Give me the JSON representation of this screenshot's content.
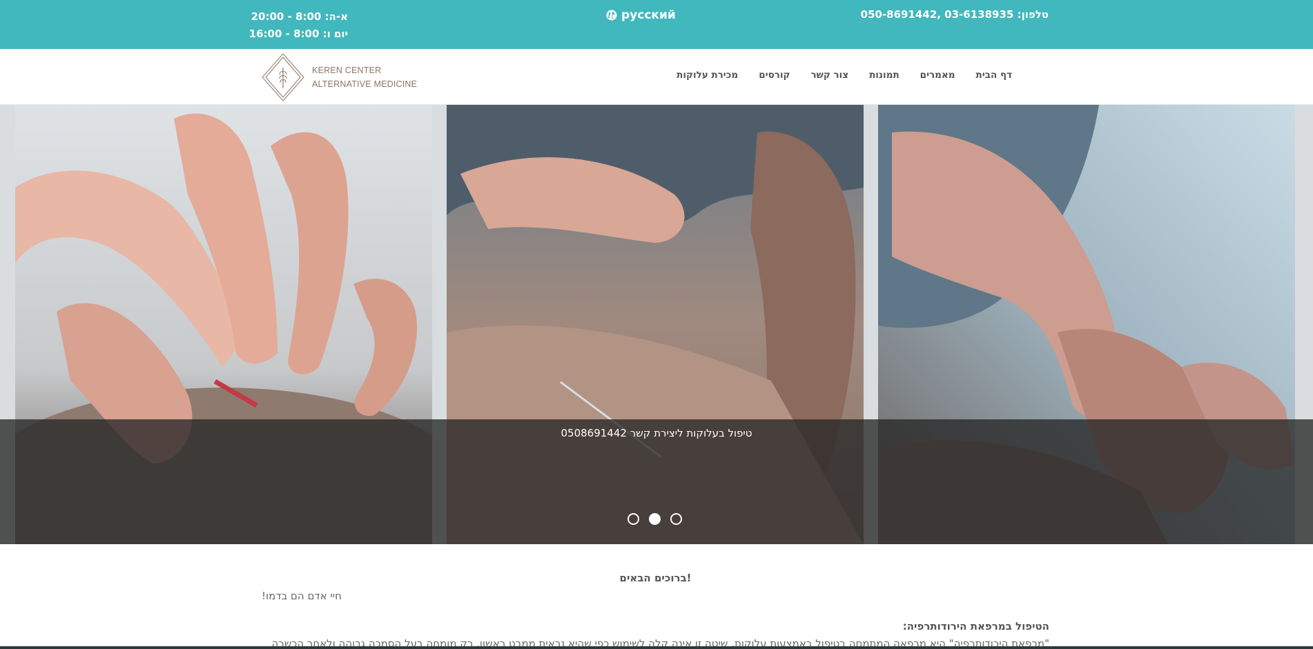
{
  "topbar": {
    "hours_weekdays": "א-ה: 8:00 - 20:00",
    "hours_friday": "יום ו: 8:00 - 16:00",
    "language_label": "русский",
    "language_icon": "globe-icon",
    "phone": "טלפון: 03-6138935 ,050-8691442"
  },
  "logo": {
    "line1": "KEREN CENTER",
    "line2": "ALTERNATIVE MEDICINE"
  },
  "nav": {
    "items": [
      {
        "label": "דף הבית"
      },
      {
        "label": "מאמרים"
      },
      {
        "label": "תמונות"
      },
      {
        "label": "צור קשר"
      },
      {
        "label": "קורסים"
      },
      {
        "label": "מכירת עלוקות"
      }
    ]
  },
  "slider": {
    "caption": "טיפול בעלוקות ליצירת קשר 0508691442",
    "total_slides": 3,
    "active_slide": 2
  },
  "content": {
    "welcome": "ברוכים הבאים!",
    "tagline": "חיי אדם הם בדמו!",
    "section_title": "הטיפול במרפאת הירודותרפיה:",
    "paragraph": "\"מרפאת הירודותרפיה\" היא מרפאה המתמחה בטיפול באמצעות עלוקות. שיטה זו אינה קלה לשימוש כפי שהיא נראית ממבט ראשון. רק מומחה בעל הסמכה גבוהה ולאחר הכשרה מיוחדת"
  },
  "colors": {
    "topbar": "#41b8be",
    "caption_overlay": "#282828"
  }
}
